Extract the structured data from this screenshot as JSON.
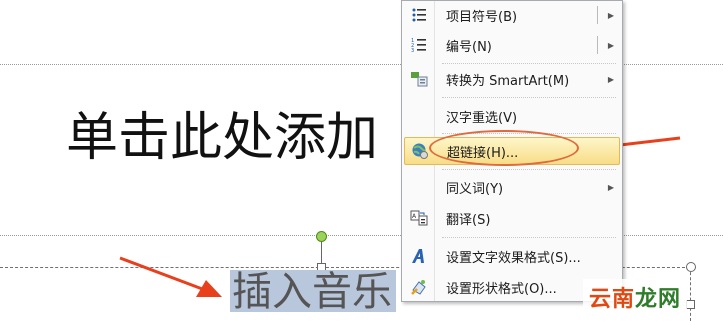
{
  "slide": {
    "title_placeholder": "单击此处添加",
    "selected_text": "插入音乐"
  },
  "context_menu": {
    "items": [
      {
        "label": "项目符号(B)",
        "icon": "bullets-icon",
        "submenu": true,
        "split": true
      },
      {
        "label": "编号(N)",
        "icon": "numbering-icon",
        "submenu": true,
        "split": true
      },
      {
        "label": "转换为 SmartArt(M)",
        "icon": "smartart-icon",
        "submenu": true
      },
      {
        "label": "汉字重选(V)",
        "icon": "",
        "submenu": false
      },
      {
        "label": "超链接(H)...",
        "icon": "hyperlink-icon",
        "submenu": false,
        "highlighted": true
      },
      {
        "label": "同义词(Y)",
        "icon": "",
        "submenu": true
      },
      {
        "label": "翻译(S)",
        "icon": "translate-icon",
        "submenu": false
      },
      {
        "label": "设置文字效果格式(S)...",
        "icon": "text-effects-icon",
        "submenu": false
      },
      {
        "label": "设置形状格式(O)...",
        "icon": "shape-format-icon",
        "submenu": false
      }
    ]
  },
  "annotations": {
    "arrow_color": "#e8401c",
    "ellipse_color": "#e06a3b"
  },
  "watermark": {
    "part1": "云南",
    "part2": "龙网"
  },
  "colors": {
    "highlight_top": "#fdf6c9",
    "highlight_bottom": "#f8dd87",
    "selection": "#b9c7dd"
  }
}
